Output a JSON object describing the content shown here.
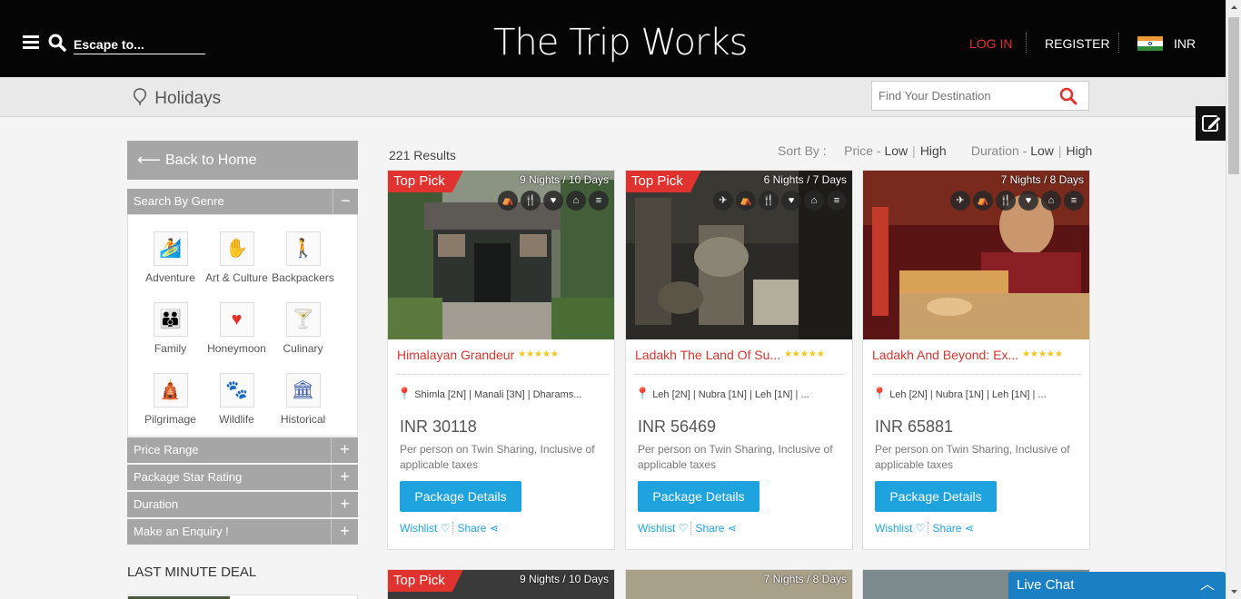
{
  "header": {
    "search_placeholder": "Escape to...",
    "logo": "The Trip Works",
    "login": "LOG IN",
    "register": "REGISTER",
    "currency": "INR"
  },
  "subheader": {
    "title": "Holidays",
    "find_placeholder": "Find Your Destination"
  },
  "sidebar": {
    "back": "Back to Home",
    "genre_title": "Search By Genre",
    "genre_toggle": "−",
    "genres": [
      {
        "label": "Adventure",
        "icon": "adventure-icon"
      },
      {
        "label": "Art & Culture",
        "icon": "art-culture-icon"
      },
      {
        "label": "Backpackers",
        "icon": "backpackers-icon"
      },
      {
        "label": "Family",
        "icon": "family-icon"
      },
      {
        "label": "Honeymoon",
        "icon": "heart-icon"
      },
      {
        "label": "Culinary",
        "icon": "cocktail-icon"
      },
      {
        "label": "Pilgrimage",
        "icon": "temple-icon"
      },
      {
        "label": "Wildlife",
        "icon": "paw-icon"
      },
      {
        "label": "Historical",
        "icon": "monument-icon"
      }
    ],
    "filters": [
      "Price Range",
      "Package Star Rating",
      "Duration",
      "Make an Enquiry !"
    ],
    "filter_toggle": "+",
    "last_minute": "LAST MINUTE DEAL"
  },
  "results": {
    "count": "221 Results",
    "sort_label": "Sort By :",
    "price_label": "Price -",
    "duration_label": "Duration -",
    "low": "Low",
    "high": "High"
  },
  "cards": [
    {
      "badge": "Top Pick",
      "nights": "9 Nights / 10 Days",
      "title": "Himalayan Grandeur",
      "stars": "★★★★★",
      "route": "Shimla [2N] | Manali [3N] | Dharams...",
      "price": "INR 30118",
      "note": "Per person on Twin Sharing, Inclusive of applicable taxes",
      "button": "Package Details",
      "wishlist": "Wishlist",
      "share": "Share"
    },
    {
      "badge": "Top Pick",
      "nights": "6 Nights / 7 Days",
      "title": "Ladakh The Land Of Su...",
      "stars": "★★★★★",
      "route": "Leh [2N] | Nubra [1N] | Leh [1N] | ...",
      "price": "INR 56469",
      "note": "Per person on Twin Sharing, Inclusive of applicable taxes",
      "button": "Package Details",
      "wishlist": "Wishlist",
      "share": "Share"
    },
    {
      "badge": "",
      "nights": "7 Nights / 8 Days",
      "title": "Ladakh And Beyond: Ex...",
      "stars": "★★★★★",
      "route": "Leh [2N] | Nubra [1N] | Leh [1N] | ...",
      "price": "INR 65881",
      "note": "Per person on Twin Sharing, Inclusive of applicable taxes",
      "button": "Package Details",
      "wishlist": "Wishlist",
      "share": "Share"
    }
  ],
  "next_row": [
    {
      "badge": "Top Pick",
      "nights": "9 Nights / 10 Days"
    },
    {
      "badge": "",
      "nights": "7 Nights / 8 Days"
    },
    {
      "badge": "",
      "nights": ""
    }
  ],
  "live_chat": "Live Chat",
  "colors": {
    "accent_red": "#e0332f",
    "button_blue": "#1fa3de",
    "chat_blue": "#1a80c3",
    "sidebar_gray": "#a6a6a6"
  }
}
